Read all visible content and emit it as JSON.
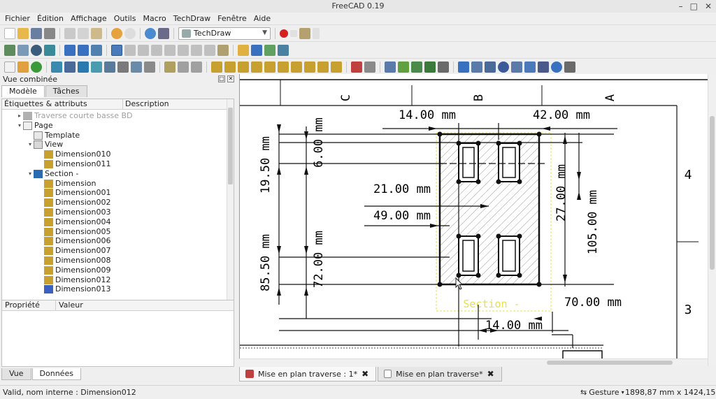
{
  "window": {
    "title": "FreeCAD 0.19"
  },
  "menubar": [
    "Fichier",
    "Édition",
    "Affichage",
    "Outils",
    "Macro",
    "TechDraw",
    "Fenêtre",
    "Aide"
  ],
  "toolbar": {
    "workbench": "TechDraw"
  },
  "combo": {
    "title": "Vue combinée",
    "tabs": [
      "Modèle",
      "Tâches"
    ],
    "tree_headers": [
      "Étiquettes & attributs",
      "Description"
    ],
    "tree": [
      {
        "label": "Traverse courte basse BD",
        "depth": 1,
        "exp": "▸",
        "icon": "part-icon",
        "greyed": true
      },
      {
        "label": "Page",
        "depth": 1,
        "exp": "▾",
        "icon": "page-icon"
      },
      {
        "label": "Template",
        "depth": 2,
        "exp": "",
        "icon": "template-icon"
      },
      {
        "label": "View",
        "depth": 2,
        "exp": "▾",
        "icon": "view-icon"
      },
      {
        "label": "Dimension010",
        "depth": 3,
        "exp": "",
        "icon": "hdim-icon"
      },
      {
        "label": "Dimension011",
        "depth": 3,
        "exp": "",
        "icon": "vdim-icon"
      },
      {
        "label": "Section  -",
        "depth": 2,
        "exp": "▾",
        "icon": "section-icon"
      },
      {
        "label": "Dimension",
        "depth": 3,
        "exp": "",
        "icon": "vdim-icon"
      },
      {
        "label": "Dimension001",
        "depth": 3,
        "exp": "",
        "icon": "hdim-icon"
      },
      {
        "label": "Dimension002",
        "depth": 3,
        "exp": "",
        "icon": "vdim-icon"
      },
      {
        "label": "Dimension003",
        "depth": 3,
        "exp": "",
        "icon": "hdim-icon"
      },
      {
        "label": "Dimension004",
        "depth": 3,
        "exp": "",
        "icon": "vdim-icon"
      },
      {
        "label": "Dimension005",
        "depth": 3,
        "exp": "",
        "icon": "hdim-icon"
      },
      {
        "label": "Dimension006",
        "depth": 3,
        "exp": "",
        "icon": "vdim-icon"
      },
      {
        "label": "Dimension007",
        "depth": 3,
        "exp": "",
        "icon": "hdim-icon"
      },
      {
        "label": "Dimension008",
        "depth": 3,
        "exp": "",
        "icon": "hdim-icon"
      },
      {
        "label": "Dimension009",
        "depth": 3,
        "exp": "",
        "icon": "hdim-icon"
      },
      {
        "label": "Dimension012",
        "depth": 3,
        "exp": "",
        "icon": "vdim-icon"
      },
      {
        "label": "Dimension013",
        "depth": 3,
        "exp": "",
        "icon": "vdim-edit-icon"
      }
    ],
    "props_headers": [
      "Propriété",
      "Valeur"
    ],
    "bottom_tabs": [
      "Vue",
      "Données"
    ]
  },
  "drawing": {
    "zone_letters": [
      "C",
      "B",
      "A"
    ],
    "zone_numbers": [
      "4",
      "3"
    ],
    "section_label": "Section  -",
    "dims": {
      "top_left": "14.00  mm",
      "top_right": "42.00  mm",
      "left_1950": "19.50  mm",
      "left_600": "6.00  mm",
      "mid_2100": "21.00  mm",
      "mid_4900": "49.00  mm",
      "right_2700": "27.00  mm",
      "right_10500": "105.00  mm",
      "left_8550": "85.50  mm",
      "left_7200": "72.00  mm",
      "right_7000": "70.00  mm",
      "bottom_1400": "14.00  mm"
    }
  },
  "doc_tabs": [
    {
      "label": "Mise en plan traverse : 1*",
      "close": "✖"
    },
    {
      "label": "Mise en plan traverse*",
      "close": "✖"
    }
  ],
  "status": {
    "message": "Valid, nom interne : Dimension012",
    "nav_style": "Gesture",
    "dimensions": "1898,87 mm x 1424,15 mm"
  },
  "colors": {
    "accent": "#3a78c8",
    "section_hatch": "#9a9a9a",
    "section_label": "#e8e050"
  }
}
